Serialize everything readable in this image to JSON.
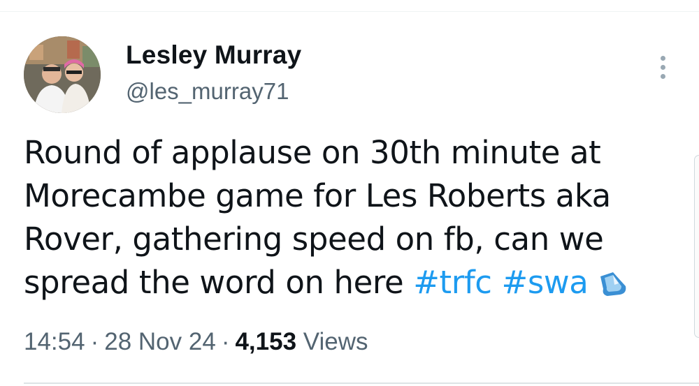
{
  "author": {
    "display_name": "Lesley Murray",
    "handle": "@les_murray71"
  },
  "tweet": {
    "text_lines": [
      "Round of applause on 30th minute  at",
      "Morecambe game for Les Roberts aka",
      "Rover, gathering speed on fb, can we",
      "spread the word on here "
    ],
    "hashtags": [
      "#trfc",
      "#swa"
    ],
    "emoji": "droplet-icon"
  },
  "meta": {
    "time": "14:54",
    "separator": "·",
    "date": "28 Nov 24",
    "views_count": "4,153",
    "views_label": "Views"
  },
  "colors": {
    "link": "#1d9bf0",
    "secondary_text": "#536471",
    "primary_text": "#0f1419"
  }
}
